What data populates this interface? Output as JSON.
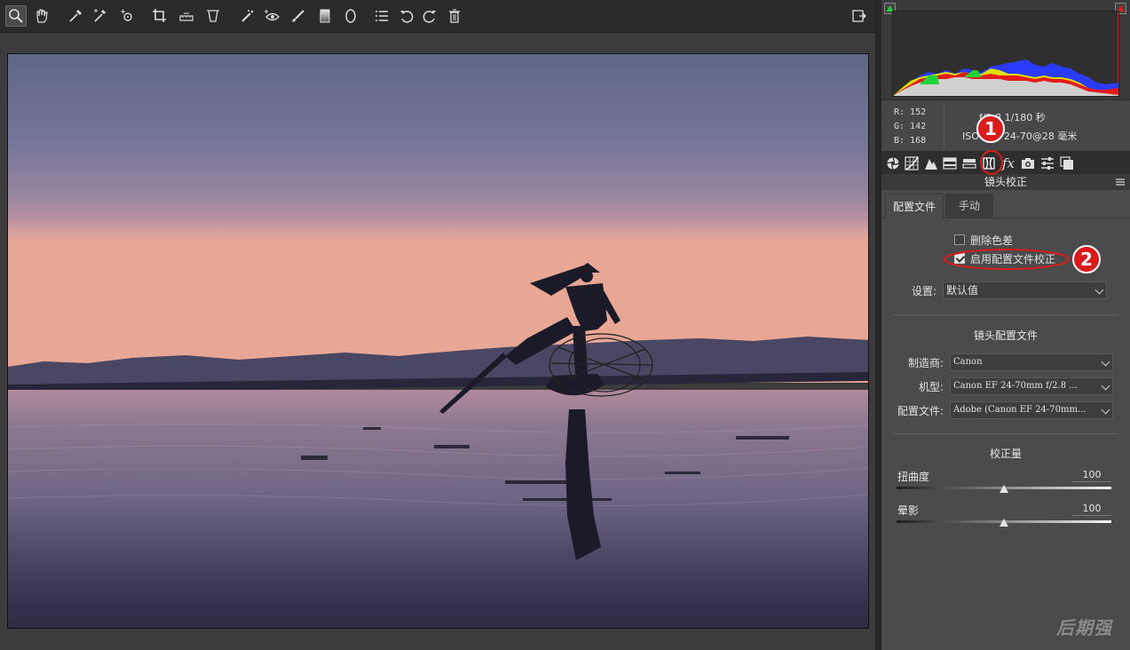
{
  "histogram": {
    "rgb": {
      "r": "R:  152",
      "g": "G:  142",
      "b": "B:  168"
    },
    "exif_line1": "f/2.8   1/180 秒",
    "exif_line2": "ISO 100   24-70@28 毫米"
  },
  "panel": {
    "title": "镜头校正",
    "tabs": [
      "配置文件",
      "手动"
    ],
    "remove_ca_label": "删除色差",
    "enable_profile_label": "启用配置文件校正",
    "settings_label": "设置:",
    "settings_value": "默认值",
    "lens_profile_title": "镜头配置文件",
    "make_label": "制造商:",
    "make_value": "Canon",
    "model_label": "机型:",
    "model_value": "Canon EF 24-70mm f/2.8 ...",
    "profile_label": "配置文件:",
    "profile_value": "Adobe (Canon EF 24-70mm...",
    "correction_title": "校正量",
    "distortion_label": "扭曲度",
    "distortion_value": "100",
    "vignetting_label": "晕影",
    "vignetting_value": "100"
  },
  "annotations": {
    "badge1": "1",
    "badge2": "2"
  },
  "watermark": "后期强",
  "colors": {
    "accent_red": "#d81b1b",
    "panel_bg": "#4b4b4b"
  }
}
